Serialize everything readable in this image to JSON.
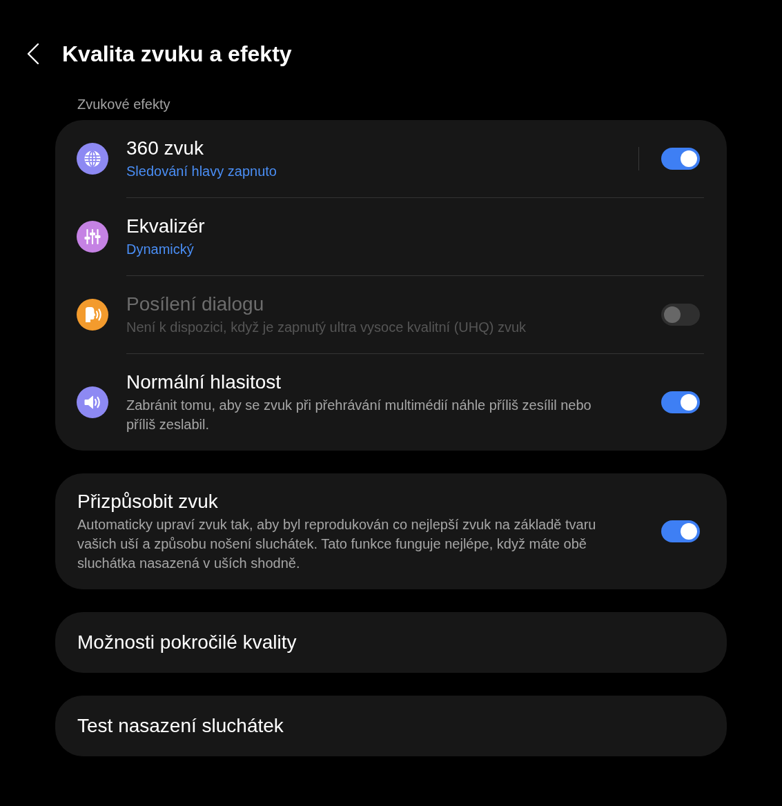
{
  "header": {
    "title": "Kvalita zvuku a efekty"
  },
  "groups": [
    {
      "label": "Zvukové efekty",
      "items": [
        {
          "kind": "split_switch",
          "color": "#8d89f3",
          "title": "360 zvuk",
          "summary": "Sledování hlavy zapnuto",
          "on": true,
          "disabled": false
        },
        {
          "kind": "link",
          "color": "#c582e4",
          "title": "Ekvalizér",
          "summary": "Dynamický"
        },
        {
          "kind": "switch",
          "color": "#f39b2d",
          "title": "Posílení dialogu",
          "description": "Není k dispozici, když je zapnutý ultra vysoce kvalitní (UHQ) zvuk",
          "on": false,
          "disabled": true
        },
        {
          "kind": "switch",
          "color": "#8d89f3",
          "title": "Normální hlasitost",
          "description": "Zabránit tomu, aby se zvuk při přehrávání multimédií náhle příliš zesílil nebo příliš zeslabil.",
          "on": true,
          "disabled": false
        }
      ]
    },
    {
      "items": [
        {
          "kind": "switch",
          "title": "Přizpůsobit zvuk",
          "description": "Automaticky upraví zvuk tak, aby byl reprodukován co nejlepší zvuk na základě tvaru vašich uší a způsobu nošení sluchátek. Tato funkce funguje nejlépe, když máte obě sluchátka nasazená v uších shodně.",
          "on": true,
          "disabled": false
        }
      ]
    },
    {
      "items": [
        {
          "kind": "link",
          "title": "Možnosti pokročilé kvality"
        }
      ]
    },
    {
      "items": [
        {
          "kind": "link",
          "title": "Test nasazení sluchátek"
        }
      ]
    }
  ]
}
